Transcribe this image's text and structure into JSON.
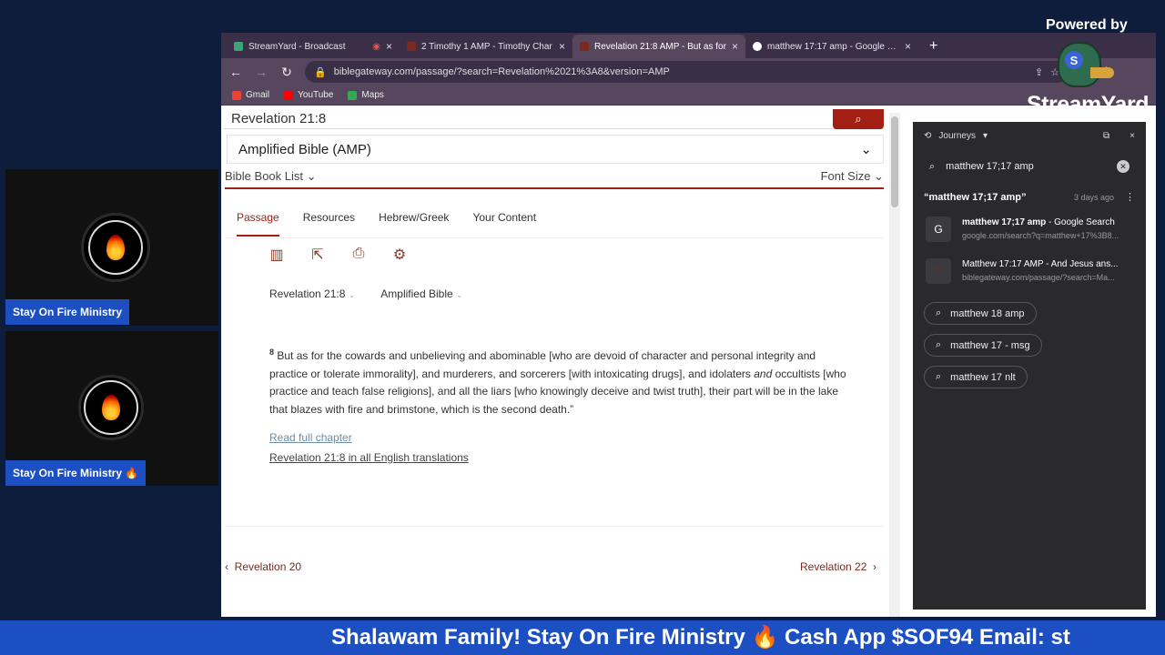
{
  "colors": {
    "accent": "#a31f13",
    "stream_blue": "#1b4fc2",
    "background": "#0f1d3d"
  },
  "participants": [
    {
      "name": "Stay On Fire Ministry"
    },
    {
      "name": "Stay On Fire Ministry 🔥"
    }
  ],
  "browser": {
    "tabs": [
      {
        "title": "StreamYard - Broadcast",
        "icon": "streamyard-icon"
      },
      {
        "title": "2 Timothy 1 AMP - Timothy Char",
        "icon": "biblegateway-icon"
      },
      {
        "title": "Revelation 21:8 AMP - But as for",
        "icon": "biblegateway-icon",
        "active": true
      },
      {
        "title": "matthew 17:17 amp - Google Sea",
        "icon": "google-icon"
      }
    ],
    "url": "biblegateway.com/passage/?search=Revelation%2021%3A8&version=AMP",
    "bookmarks": [
      "Gmail",
      "YouTube",
      "Maps"
    ]
  },
  "page": {
    "search_value": "Revelation 21:8",
    "version": "Amplified Bible (AMP)",
    "book_list": "Bible Book List",
    "font_size": "Font Size",
    "tabs": [
      "Passage",
      "Resources",
      "Hebrew/Greek",
      "Your Content"
    ],
    "ref_passage": "Revelation 21:8",
    "ref_version": "Amplified Bible",
    "verse_number": "8",
    "verse_text_a": "But as for the cowards and unbelieving and abominable [who are devoid of character and personal integrity and practice or tolerate immorality], and murderers, and sorcerers [with intoxicating drugs], and idolaters ",
    "verse_italic": "and",
    "verse_text_b": " occultists [who practice and teach false religions], and all the liars [who knowingly deceive and twist truth], their part will be in the lake that blazes with fire and brimstone, which is the second death.”",
    "read_full": "Read full chapter",
    "all_translations": "Revelation 21:8 in all English translations",
    "prev": "Revelation 20",
    "next": "Revelation 22"
  },
  "panel": {
    "title": "Journeys",
    "search": "matthew 17;17 amp",
    "journey_title": "“matthew 17;17 amp”",
    "journey_ago": "3 days ago",
    "results": [
      {
        "title_bold": "matthew 17;17 amp",
        "title_rest": " - Google Search",
        "url": "google.com/search?q=matthew+17%3B8..."
      },
      {
        "title_bold": "",
        "title_rest": "Matthew 17:17 AMP - And Jesus ans...",
        "url": "biblegateway.com/passage/?search=Ma..."
      }
    ],
    "chips": [
      "matthew 18 amp",
      "matthew 17 - msg",
      "matthew 17 nlt"
    ]
  },
  "branding": {
    "powered_by": "Powered by",
    "name": "StreamYard"
  },
  "ticker": "Shalawam Family! Stay On Fire Ministry 🔥 Cash App $SOF94 Email: st"
}
